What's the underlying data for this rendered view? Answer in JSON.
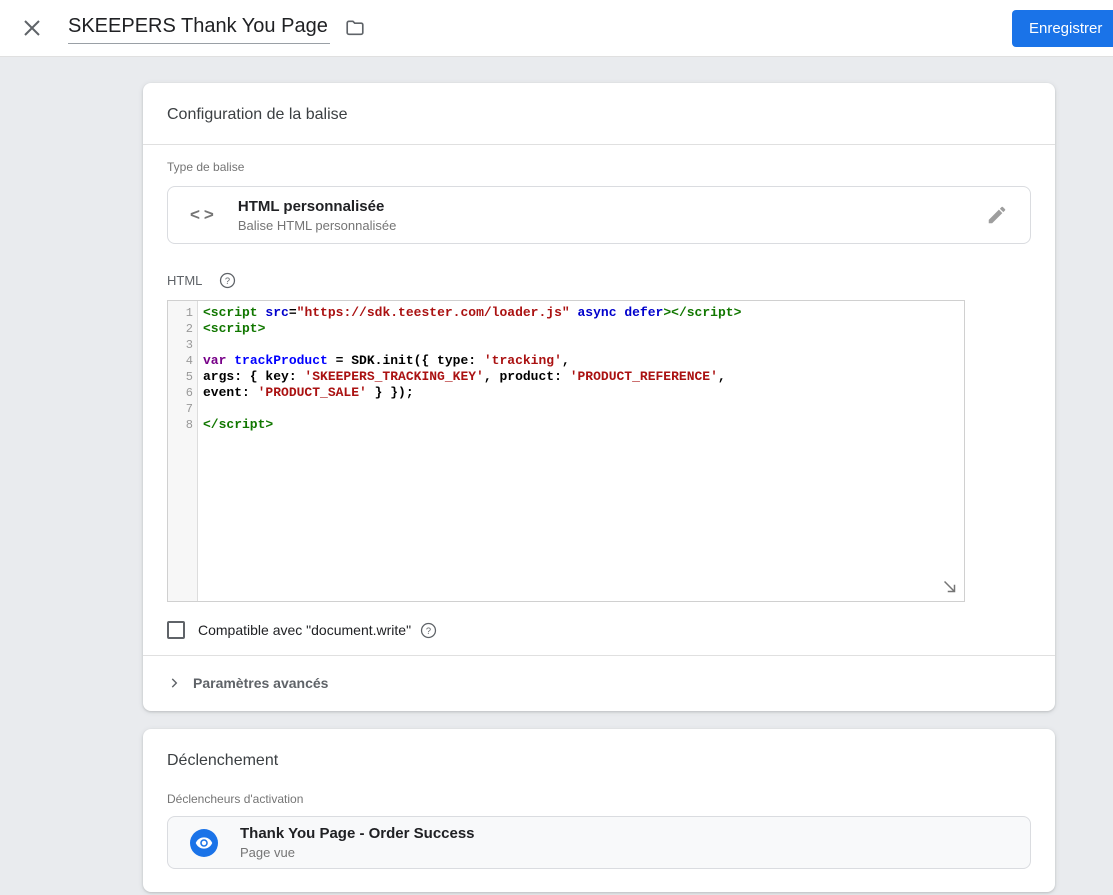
{
  "header": {
    "tag_name": "SKEEPERS Thank You Page",
    "save_label": "Enregistrer"
  },
  "tag_config": {
    "title": "Configuration de la balise",
    "type_label": "Type de balise",
    "type_name": "HTML personnalisée",
    "type_description": "Balise HTML personnalisée",
    "html_label": "HTML",
    "code_lines": [
      {
        "tokens": [
          [
            "tag",
            "<script"
          ],
          [
            "pln",
            " "
          ],
          [
            "att",
            "src"
          ],
          [
            "pln",
            "="
          ],
          [
            "str",
            "\"https://sdk.teester.com/loader.js\""
          ],
          [
            "pln",
            " "
          ],
          [
            "att",
            "async"
          ],
          [
            "pln",
            " "
          ],
          [
            "att",
            "defer"
          ],
          [
            "tag",
            ">"
          ],
          [
            "tag",
            "</script>"
          ]
        ]
      },
      {
        "tokens": [
          [
            "tag",
            "<script>"
          ]
        ]
      },
      {
        "tokens": []
      },
      {
        "tokens": [
          [
            "kwd",
            "var"
          ],
          [
            "pln",
            " "
          ],
          [
            "def",
            "trackProduct"
          ],
          [
            "pln",
            " = SDK.init({ type: "
          ],
          [
            "str",
            "'tracking'"
          ],
          [
            "pln",
            ","
          ]
        ]
      },
      {
        "tokens": [
          [
            "pln",
            "args: { key: "
          ],
          [
            "str",
            "'SKEEPERS_TRACKING_KEY'"
          ],
          [
            "pln",
            ", product: "
          ],
          [
            "str",
            "'PRODUCT_REFERENCE'"
          ],
          [
            "pln",
            ","
          ]
        ]
      },
      {
        "tokens": [
          [
            "pln",
            "event: "
          ],
          [
            "str",
            "'PRODUCT_SALE'"
          ],
          [
            "pln",
            " } });"
          ]
        ]
      },
      {
        "tokens": []
      },
      {
        "tokens": [
          [
            "tag",
            "</script>"
          ]
        ]
      }
    ],
    "docwrite_label": "Compatible avec \"document.write\"",
    "docwrite_checked": false,
    "advanced_label": "Paramètres avancés"
  },
  "trigger_section": {
    "title": "Déclenchement",
    "triggers_label": "Déclencheurs d'activation",
    "trigger_name": "Thank You Page - Order Success",
    "trigger_type": "Page vue"
  },
  "icons": {
    "close": "close-icon",
    "folder": "folder-icon",
    "code": "code-angle-brackets-icon",
    "edit": "pencil-icon",
    "help": "help-circle-icon",
    "resize": "resize-south-east-icon",
    "chevron": "chevron-right-icon",
    "eye": "visibility-eye-icon"
  },
  "colors": {
    "accent_blue": "#1a73e8",
    "code_tag": "#117700",
    "code_attribute": "#0000cc",
    "code_string": "#aa1111",
    "code_keyword": "#770088",
    "code_def": "#0000ff"
  }
}
